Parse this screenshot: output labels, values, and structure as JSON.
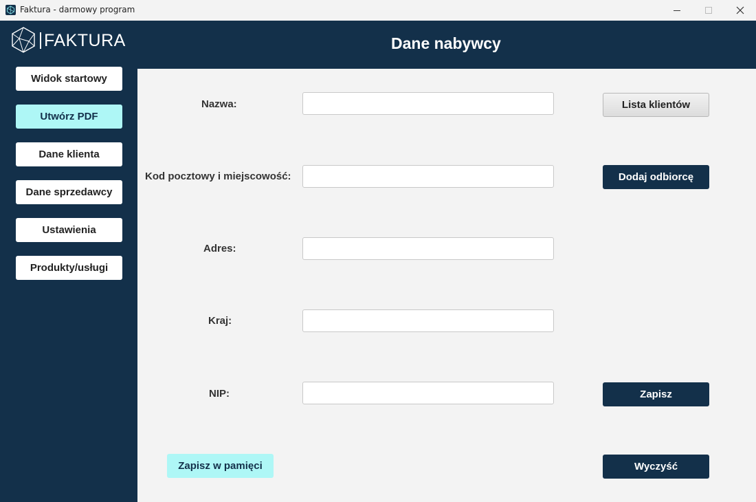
{
  "window": {
    "title": "Faktura - darmowy program"
  },
  "logo": {
    "text": "FAKTURA"
  },
  "header": {
    "title": "Dane nabywcy"
  },
  "sidebar": {
    "items": [
      {
        "label": "Widok startowy"
      },
      {
        "label": "Utwórz PDF"
      },
      {
        "label": "Dane klienta"
      },
      {
        "label": "Dane sprzedawcy"
      },
      {
        "label": "Ustawienia"
      },
      {
        "label": "Produkty/usługi"
      }
    ]
  },
  "form": {
    "fields": [
      {
        "label": "Nazwa:",
        "value": ""
      },
      {
        "label": "Kod pocztowy i miejscowość:",
        "value": ""
      },
      {
        "label": "Adres:",
        "value": ""
      },
      {
        "label": "Kraj:",
        "value": ""
      },
      {
        "label": "NIP:",
        "value": ""
      }
    ]
  },
  "buttons": {
    "client_list": "Lista klientów",
    "add_recipient": "Dodaj odbiorcę",
    "save": "Zapisz",
    "save_memory": "Zapisz w pamięci",
    "clear": "Wyczyść"
  },
  "colors": {
    "navy": "#13304a",
    "accent_cyan": "#aef7f6",
    "background": "#f3f3f3"
  }
}
